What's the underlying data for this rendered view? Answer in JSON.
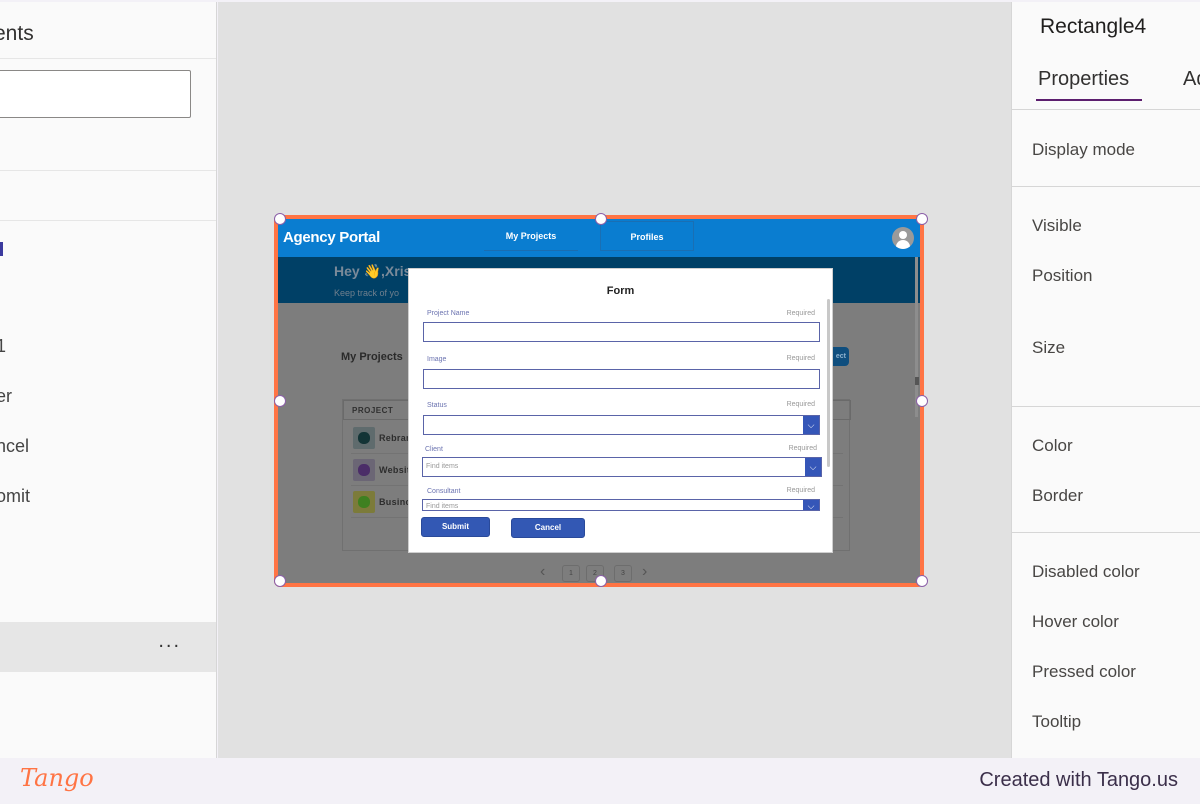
{
  "left_panel": {
    "title_fragment": "ents",
    "search": {
      "value": "",
      "placeholder": ""
    },
    "items": [
      "1",
      "er",
      "ncel",
      "omit"
    ],
    "selected_item_more": "..."
  },
  "app": {
    "title": "Agency Portal",
    "nav": [
      "My Projects",
      "Profiles"
    ],
    "greeting": "Hey",
    "greeting_emoji": "👋",
    "greeting_name": ",Xris",
    "greeting_sub": "Keep track of yo",
    "section_title": "My Projects",
    "new_button": "ect",
    "table": {
      "header": "PROJECT",
      "rows": [
        {
          "name": "Rebran",
          "thumb_bg": "#c9dfe3",
          "blob": "#0f4a4e"
        },
        {
          "name": "Websit",
          "thumb_bg": "#d9d0e6",
          "blob": "#6a3a9a"
        },
        {
          "name": "Businc",
          "thumb_bg": "#f0ea60",
          "blob": "#4fc41f"
        }
      ]
    },
    "pager": {
      "pages": [
        "1",
        "2",
        "3"
      ],
      "prev": "‹",
      "next": "›"
    }
  },
  "form": {
    "title": "Form",
    "fields": [
      {
        "label": "Project Name",
        "required": "Required",
        "type": "text",
        "value": "",
        "placeholder": ""
      },
      {
        "label": "Image",
        "required": "Required",
        "type": "text",
        "value": "",
        "placeholder": ""
      },
      {
        "label": "Status",
        "required": "Required",
        "type": "dropdown",
        "value": "",
        "placeholder": ""
      },
      {
        "label": "Client",
        "required": "Required",
        "type": "combobox",
        "value": "",
        "placeholder": "Find items"
      },
      {
        "label": "Consultant",
        "required": "Required",
        "type": "combobox",
        "value": "",
        "placeholder": "Find items"
      }
    ],
    "submit": "Submit",
    "cancel": "Cancel"
  },
  "selection": {
    "control_name": "Rectangle4",
    "frame_color": "#ff7444"
  },
  "right_panel": {
    "title": "Rectangle4",
    "tabs": [
      "Properties",
      "Ad"
    ],
    "active_tab": "Properties",
    "properties": [
      "Display mode",
      "Visible",
      "Position",
      "Size",
      "Color",
      "Border",
      "Disabled color",
      "Hover color",
      "Pressed color",
      "Tooltip"
    ]
  },
  "footer": {
    "logo": "Tango",
    "credit": "Created with Tango.us"
  },
  "colors": {
    "app_header": "#0a7dd0",
    "banner": "#004066",
    "form_button": "#3358b4",
    "tab_underline": "#5c1e6e",
    "tango_orange": "#ff7444"
  }
}
